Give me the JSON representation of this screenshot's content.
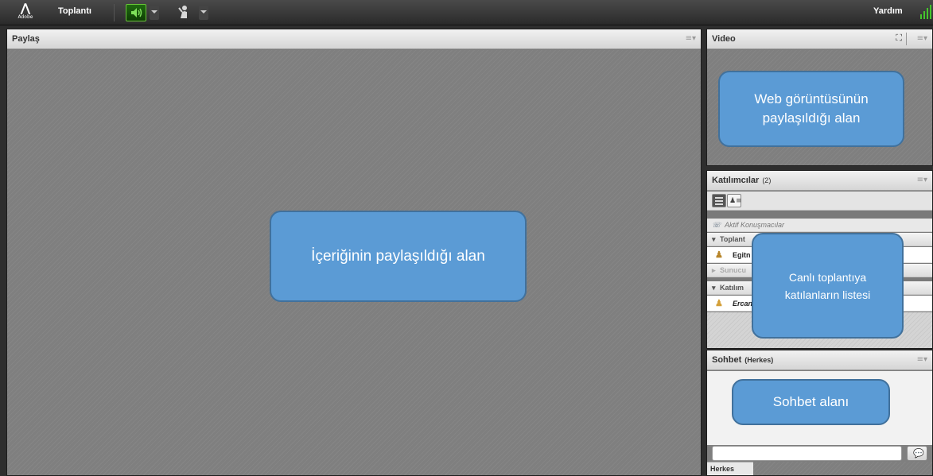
{
  "topbar": {
    "logo_text": "Adobe",
    "menu_meeting": "Toplantı",
    "menu_help": "Yardım"
  },
  "share_panel": {
    "title": "Paylaş",
    "callout": "İçeriğinin paylaşıldığı alan"
  },
  "video_panel": {
    "title": "Video",
    "callout": "Web görüntüsünün paylaşıldığı alan"
  },
  "participants_panel": {
    "title": "Katılımcılar",
    "count": "(2)",
    "active_speakers": "Aktif Konuşmacılar",
    "group_hosts": "Toplant",
    "host_user": "Egitn",
    "group_presenters": "Sunucu",
    "group_participants": "Katılım",
    "participant_user": "Ercan",
    "callout": "Canlı toplantıya katılanların listesi"
  },
  "chat_panel": {
    "title": "Sohbet",
    "subtitle": "(Herkes)",
    "callout": "Sohbet alanı",
    "tab_label": "Herkes"
  },
  "colors": {
    "callout_fill": "#5b9bd5",
    "callout_border": "#41719c",
    "speaker_active": "#45c42d"
  }
}
